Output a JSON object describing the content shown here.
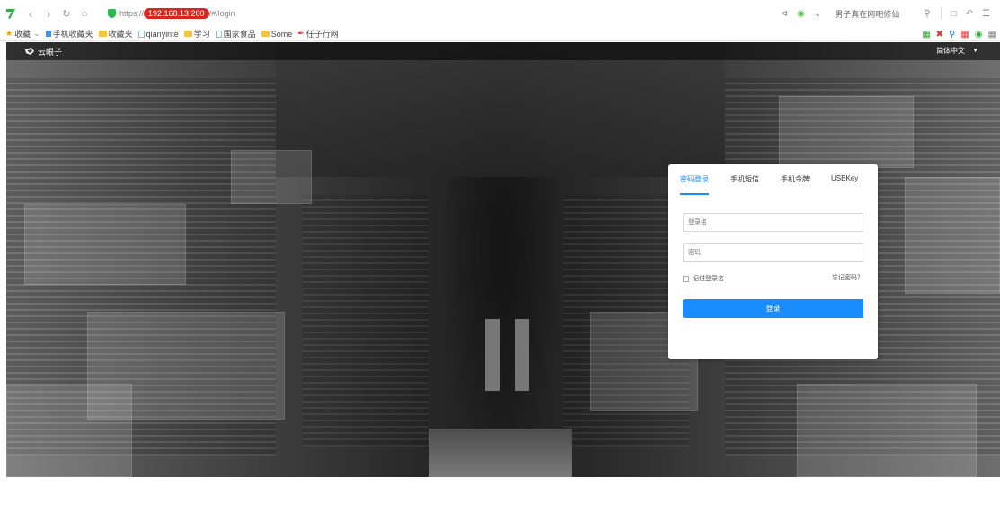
{
  "browser": {
    "url_scheme": "https://",
    "url_host": "192.168.13.200",
    "url_path": "/#/login",
    "search_suggestion": "男子真在网吧修仙",
    "bookmarks": [
      {
        "label": "收藏",
        "icon": "star-icon"
      },
      {
        "label": "手机收藏夹",
        "icon": "mobile-icon"
      },
      {
        "label": "收藏夹",
        "icon": "folder-icon"
      },
      {
        "label": "qianyinte",
        "icon": "page-icon"
      },
      {
        "label": "学习",
        "icon": "folder-icon"
      },
      {
        "label": "国家食品",
        "icon": "page-icon"
      },
      {
        "label": "Some",
        "icon": "folder-icon"
      },
      {
        "label": "任子行网",
        "icon": "feather-icon"
      }
    ]
  },
  "site": {
    "name": "云眼子",
    "language": "简体中文"
  },
  "login": {
    "tabs": [
      "密码登录",
      "手机短信",
      "手机令牌",
      "USBKey"
    ],
    "active_tab": 0,
    "username_placeholder": "登录名",
    "password_placeholder": "密码",
    "remember_label": "记住登录名",
    "forgot_label": "忘记密码？",
    "submit_label": "登录"
  },
  "colors": {
    "accent": "#1a8cff",
    "card_background": "#ffffff"
  }
}
